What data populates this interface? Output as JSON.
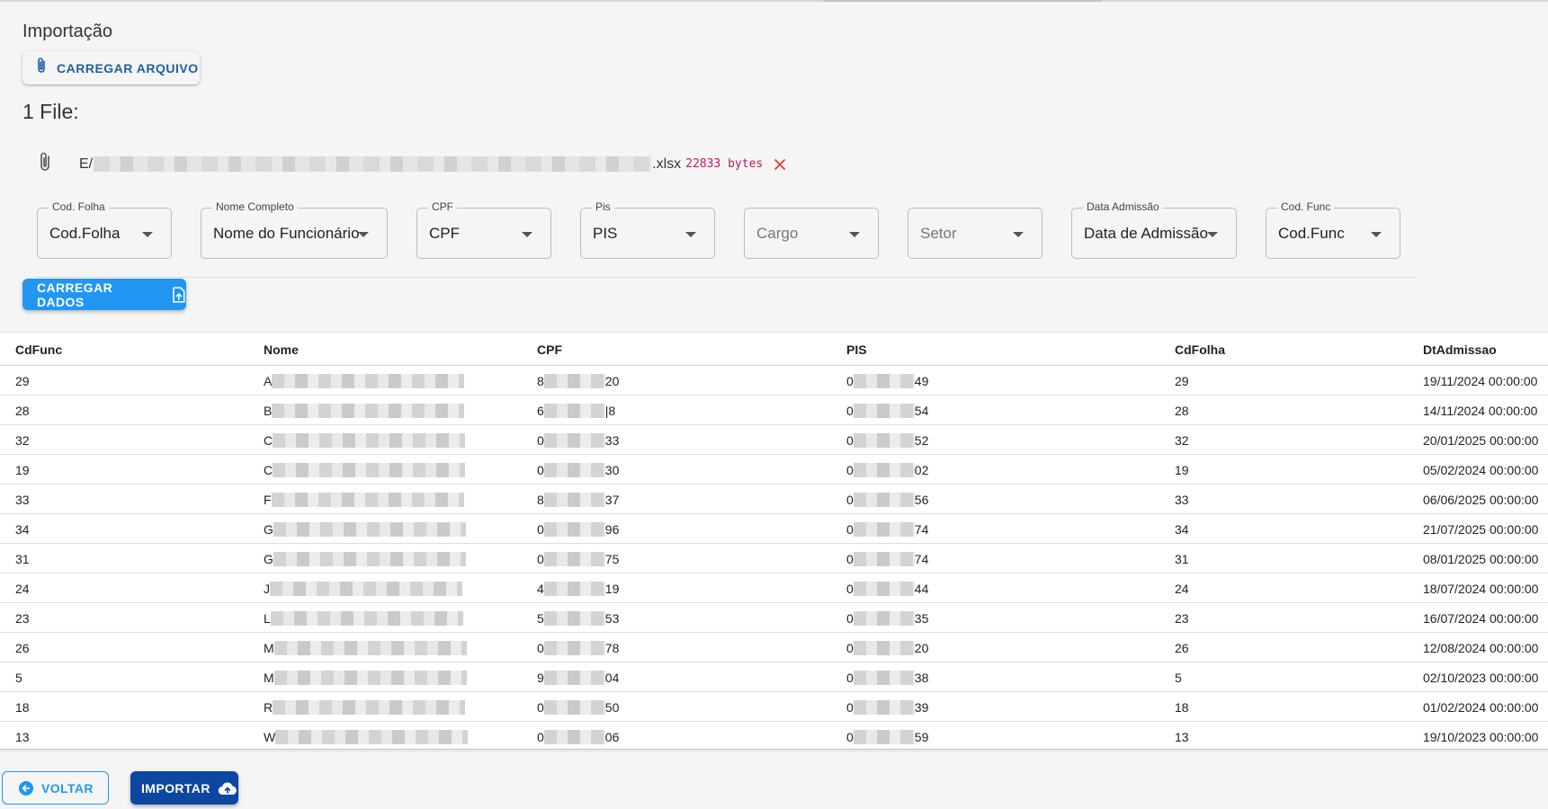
{
  "page": {
    "title": "Importação"
  },
  "upload": {
    "label": "CARREGAR ARQUIVO",
    "icon": "paperclip-icon"
  },
  "files": {
    "count_label": "1 File:",
    "items": [
      {
        "name_prefix": "E/",
        "name_suffix": ".xlsx",
        "size": "22833 bytes"
      }
    ]
  },
  "mapping": {
    "fields": [
      {
        "legend": "Cod. Folha",
        "value": "Cod.Folha",
        "placeholder": false
      },
      {
        "legend": "Nome Completo",
        "value": "Nome do Funcionário",
        "placeholder": false
      },
      {
        "legend": "CPF",
        "value": "CPF",
        "placeholder": false
      },
      {
        "legend": "Pis",
        "value": "PIS",
        "placeholder": false
      },
      {
        "legend": "",
        "value": "Cargo",
        "placeholder": true
      },
      {
        "legend": "",
        "value": "Setor",
        "placeholder": true
      },
      {
        "legend": "Data Admissão",
        "value": "Data de Admissão",
        "placeholder": false
      },
      {
        "legend": "Cod. Func",
        "value": "Cod.Func",
        "placeholder": false
      }
    ],
    "load_label": "CARREGAR DADOS"
  },
  "table": {
    "columns": [
      "CdFunc",
      "Nome",
      "CPF",
      "PIS",
      "CdFolha",
      "DtAdmissao"
    ],
    "rows": [
      {
        "cdfunc": "29",
        "nome_initial": "A",
        "cpf_start": "8",
        "cpf_end": "20",
        "pis_start": "0",
        "pis_end": "49",
        "cdfolha": "29",
        "dt": "19/11/2024 00:00:00"
      },
      {
        "cdfunc": "28",
        "nome_initial": "B",
        "cpf_start": "6",
        "cpf_end": "|8",
        "pis_start": "0",
        "pis_end": "54",
        "cdfolha": "28",
        "dt": "14/11/2024 00:00:00"
      },
      {
        "cdfunc": "32",
        "nome_initial": "C",
        "cpf_start": "0",
        "cpf_end": "33",
        "pis_start": "0",
        "pis_end": "52",
        "cdfolha": "32",
        "dt": "20/01/2025 00:00:00"
      },
      {
        "cdfunc": "19",
        "nome_initial": "C",
        "cpf_start": "0",
        "cpf_end": "30",
        "pis_start": "0",
        "pis_end": "02",
        "cdfolha": "19",
        "dt": "05/02/2024 00:00:00"
      },
      {
        "cdfunc": "33",
        "nome_initial": "F",
        "cpf_start": "8",
        "cpf_end": "37",
        "pis_start": "0",
        "pis_end": "56",
        "cdfolha": "33",
        "dt": "06/06/2025 00:00:00"
      },
      {
        "cdfunc": "34",
        "nome_initial": "G",
        "cpf_start": "0",
        "cpf_end": "96",
        "pis_start": "0",
        "pis_end": "74",
        "cdfolha": "34",
        "dt": "21/07/2025 00:00:00"
      },
      {
        "cdfunc": "31",
        "nome_initial": "G",
        "cpf_start": "0",
        "cpf_end": "75",
        "pis_start": "0",
        "pis_end": "74",
        "cdfolha": "31",
        "dt": "08/01/2025 00:00:00"
      },
      {
        "cdfunc": "24",
        "nome_initial": "J",
        "cpf_start": "4",
        "cpf_end": "19",
        "pis_start": "0",
        "pis_end": "44",
        "cdfolha": "24",
        "dt": "18/07/2024 00:00:00"
      },
      {
        "cdfunc": "23",
        "nome_initial": "L",
        "cpf_start": "5",
        "cpf_end": "53",
        "pis_start": "0",
        "pis_end": "35",
        "cdfolha": "23",
        "dt": "16/07/2024 00:00:00"
      },
      {
        "cdfunc": "26",
        "nome_initial": "M",
        "cpf_start": "0",
        "cpf_end": "78",
        "pis_start": "0",
        "pis_end": "20",
        "cdfolha": "26",
        "dt": "12/08/2024 00:00:00"
      },
      {
        "cdfunc": "5",
        "nome_initial": "M",
        "cpf_start": "9",
        "cpf_end": "04",
        "pis_start": "0",
        "pis_end": "38",
        "cdfolha": "5",
        "dt": "02/10/2023 00:00:00"
      },
      {
        "cdfunc": "18",
        "nome_initial": "R",
        "cpf_start": "0",
        "cpf_end": "50",
        "pis_start": "0",
        "pis_end": "39",
        "cdfolha": "18",
        "dt": "01/02/2024 00:00:00"
      },
      {
        "cdfunc": "13",
        "nome_initial": "W",
        "cpf_start": "0",
        "cpf_end": "06",
        "pis_start": "0",
        "pis_end": "59",
        "cdfolha": "13",
        "dt": "19/10/2023 00:00:00"
      }
    ]
  },
  "footer": {
    "back_label": "VOLTAR",
    "import_label": "IMPORTAR"
  },
  "colors": {
    "primary": "#2196f3",
    "dark_primary": "#0d47a1",
    "link": "#1f5fa0",
    "danger": "#e53935",
    "size_text": "#c2185b"
  }
}
